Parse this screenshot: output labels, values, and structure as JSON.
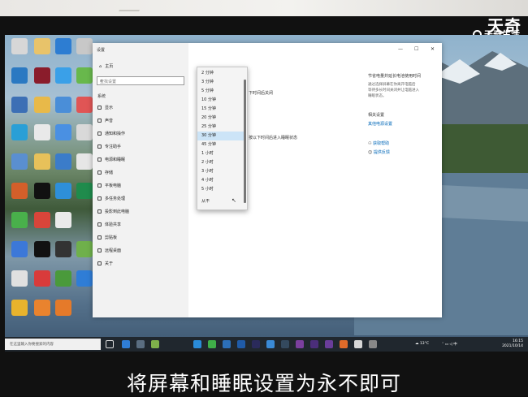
{
  "watermark": {
    "big": "天奇",
    "small": "天奇生活"
  },
  "settings": {
    "window_title": "设置",
    "home": "主页",
    "search_placeholder": "查找设置",
    "section": "系统",
    "nav": [
      "显示",
      "声音",
      "通知和操作",
      "专注助手",
      "电源和睡眠",
      "存储",
      "平板电脑",
      "多任务处理",
      "投影到此电脑",
      "体验共享",
      "剪贴板",
      "远程桌面",
      "关于"
    ],
    "main_text_1": "下时间后关闭",
    "main_text_2": "按以下时间后进入睡眠状态",
    "right_title": "节省电量并延长电池使用时间",
    "right_desc_1": "通过选择屏幕在你离开电脑后",
    "right_desc_2": "等待多长时间关闭并让电脑进入",
    "right_desc_3": "睡眠状态。",
    "related_title": "相关设置",
    "related_link": "其他电源设置",
    "help_link": "获取帮助",
    "feedback_link": "提供反馈",
    "ctrl_min": "—",
    "ctrl_max": "☐",
    "ctrl_close": "✕"
  },
  "dropdown": {
    "items": [
      "2 分钟",
      "3 分钟",
      "5 分钟",
      "10 分钟",
      "15 分钟",
      "20 分钟",
      "25 分钟",
      "30 分钟",
      "45 分钟",
      "1 小时",
      "2 小时",
      "3 小时",
      "4 小时",
      "5 小时",
      "从不"
    ],
    "selected_index": 7
  },
  "taskbar": {
    "search_placeholder": "在这里输入你要搜索的内容",
    "weather": "13°C",
    "time": "16:15",
    "date": "2021/10/14"
  },
  "subtitle": "将屏幕和睡眠设置为永不即可",
  "colors": {
    "accent": "#0067b8",
    "selected": "#cce4f7",
    "taskbar": "#20272e"
  }
}
